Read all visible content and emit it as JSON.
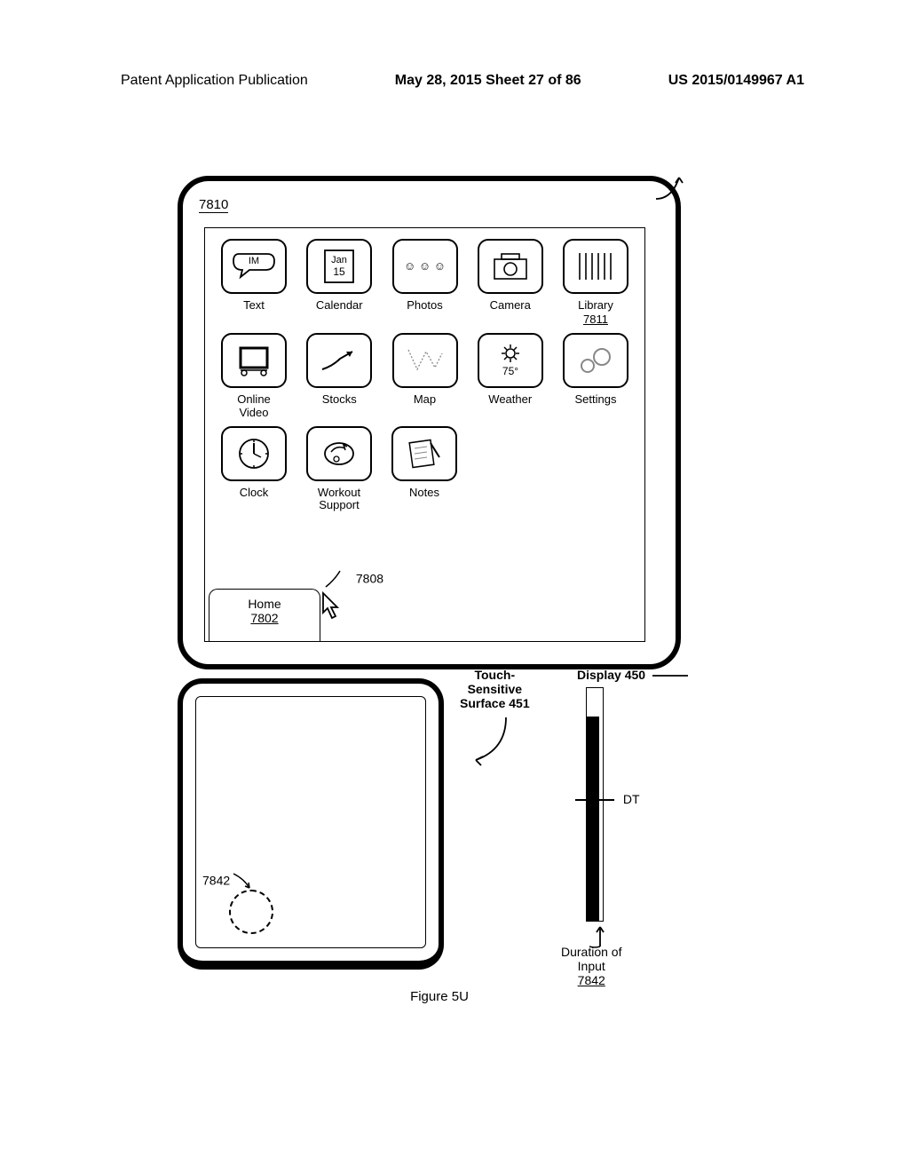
{
  "header": {
    "left": "Patent Application Publication",
    "middle": "May 28, 2015  Sheet 27 of 86",
    "right": "US 2015/0149967 A1"
  },
  "device_ref": "7810",
  "apps": {
    "r1": [
      {
        "label": "Text",
        "inner": "IM"
      },
      {
        "label": "Calendar",
        "inner": "Jan\n15"
      },
      {
        "label": "Photos",
        "inner": "☺ ☺ ☺"
      },
      {
        "label": "Camera",
        "inner": ""
      },
      {
        "label": "Library",
        "sub": "7811",
        "inner": ""
      }
    ],
    "r2": [
      {
        "label": "Online\nVideo",
        "inner": ""
      },
      {
        "label": "Stocks",
        "inner": ""
      },
      {
        "label": "Map",
        "inner": ""
      },
      {
        "label": "Weather",
        "inner": "☼\n75°"
      },
      {
        "label": "Settings",
        "inner": ""
      }
    ],
    "r3": [
      {
        "label": "Clock",
        "inner": ""
      },
      {
        "label": "Workout\nSupport",
        "inner": ""
      },
      {
        "label": "Notes",
        "inner": ""
      }
    ]
  },
  "tab": {
    "ref": "7808",
    "label": "Home",
    "sub": "7802"
  },
  "touch_label": "Touch-\nSensitive\nSurface 451",
  "display_label": "Display 450",
  "touch_ref": "7842",
  "dt_label": "DT",
  "duration_label": "Duration of\nInput",
  "duration_sub": "7842",
  "figure": "Figure 5U"
}
